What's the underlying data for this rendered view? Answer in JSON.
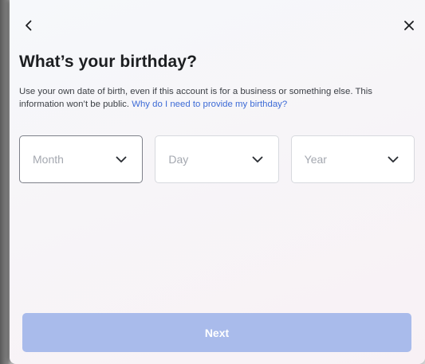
{
  "dialog": {
    "title": "What’s your birthday?",
    "description": "Use your own date of birth, even if this account is for a business or something else. This information won’t be public.",
    "help_link": "Why do I need to provide my birthday?",
    "fields": [
      {
        "placeholder": "Month"
      },
      {
        "placeholder": "Day"
      },
      {
        "placeholder": "Year"
      }
    ],
    "next_label": "Next"
  },
  "icons": {
    "back": "chevron-left-icon",
    "close": "close-icon",
    "dropdown": "chevron-down-icon"
  },
  "colors": {
    "link": "#3d6bd6",
    "button_disabled": "#a9bbeb",
    "title": "#1c1e21"
  }
}
